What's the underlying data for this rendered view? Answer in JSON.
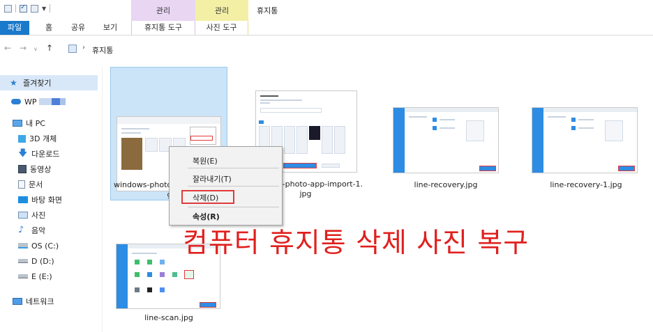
{
  "ribbon": {
    "context_header_recycle": "관리",
    "context_header_photo": "관리",
    "window_title": "휴지통",
    "tabs": [
      "파일",
      "홈",
      "공유",
      "보기",
      "휴지통 도구",
      "사진 도구"
    ]
  },
  "address": {
    "path": "휴지통"
  },
  "nav": {
    "items": [
      {
        "label": "즐겨찾기",
        "icon": "star-icon"
      },
      {
        "label": "WP",
        "icon": "cloud-icon"
      },
      {
        "label": "내 PC",
        "icon": "computer-icon"
      },
      {
        "label": "3D 개체",
        "icon": "cube-icon"
      },
      {
        "label": "다운로드",
        "icon": "download-icon"
      },
      {
        "label": "동영상",
        "icon": "video-icon"
      },
      {
        "label": "문서",
        "icon": "document-icon"
      },
      {
        "label": "바탕 화면",
        "icon": "desktop-icon"
      },
      {
        "label": "사진",
        "icon": "pictures-icon"
      },
      {
        "label": "음악",
        "icon": "music-icon"
      },
      {
        "label": "OS (C:)",
        "icon": "drive-icon"
      },
      {
        "label": "D (D:)",
        "icon": "drive-icon"
      },
      {
        "label": "E (E:)",
        "icon": "drive-icon"
      },
      {
        "label": "네트워크",
        "icon": "network-icon"
      }
    ]
  },
  "files": [
    {
      "caption_line1": "windows-photo",
      "caption_line2": "g"
    },
    {
      "caption_line1": "s-photo-app-import-1.",
      "caption_line2": "jpg"
    },
    {
      "caption_line1": "line-recovery.jpg"
    },
    {
      "caption_line1": "line-recovery-1.jpg"
    },
    {
      "caption_line1": "line-scan.jpg"
    }
  ],
  "context_menu": {
    "restore": "복원(E)",
    "cut": "잘라내기(T)",
    "delete": "삭제(D)",
    "properties": "속성(R)"
  },
  "overlay_text": "컴퓨터 휴지통 삭제 사진 복구",
  "colors": {
    "accent": "#1979ca",
    "highlight_red": "#e03a3a",
    "overlay_red": "#e0201e",
    "selection": "#cce4f7",
    "recycle_context": "#e9d6f3",
    "photo_context": "#f3f0a6"
  }
}
